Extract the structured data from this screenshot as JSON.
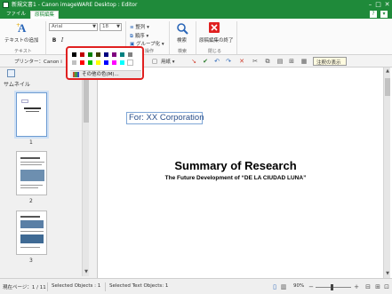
{
  "window": {
    "title": "新規文書1 - Canon imageWARE Desktop : Editor",
    "minimize": "–",
    "maximize": "□",
    "close": "✕"
  },
  "menu": {
    "tabs": [
      "ファイル",
      "原稿編集"
    ],
    "help": "?"
  },
  "ribbon": {
    "add_text": "テキストの追加",
    "text_group": "テキスト",
    "font_name": "Arial",
    "font_size": "18",
    "bold": "B",
    "italic": "I",
    "align_label": "整列",
    "resize_label": "順序",
    "group_label": "グループ化",
    "ops_label": "操作",
    "search_label": "検索",
    "search_group": "検索",
    "close_label": "原稿編集の終了",
    "close_group": "閉じる"
  },
  "toolbar": {
    "printer_label": "プリンター：Canon i",
    "paper_value": "用紙",
    "memo_label": "注釈の表示"
  },
  "thumbnails": {
    "title": "サムネイル",
    "pages": [
      "1",
      "2",
      "3"
    ]
  },
  "document": {
    "textbox": "For: XX Corporation",
    "title": "Summary of Research",
    "subtitle": "The Future Development of “DE LA CIUDAD LUNA”"
  },
  "status": {
    "page": "現在ページ：1 / 11",
    "selected_objects": "Selected Objects : 1",
    "selected_text_objects": "Selected Text Objects: 1",
    "zoom": "90%"
  },
  "color_picker": {
    "more_colors": "その他の色(M)...",
    "swatches": [
      "#000000",
      "#c00000",
      "#008000",
      "#404000",
      "#000080",
      "#7f007f",
      "#008080",
      "#808080",
      "#c0c0c0",
      "#ff0000",
      "#00c000",
      "#ffff00",
      "#0000ff",
      "#ff00ff",
      "#00ffff",
      "#ffffff"
    ]
  }
}
